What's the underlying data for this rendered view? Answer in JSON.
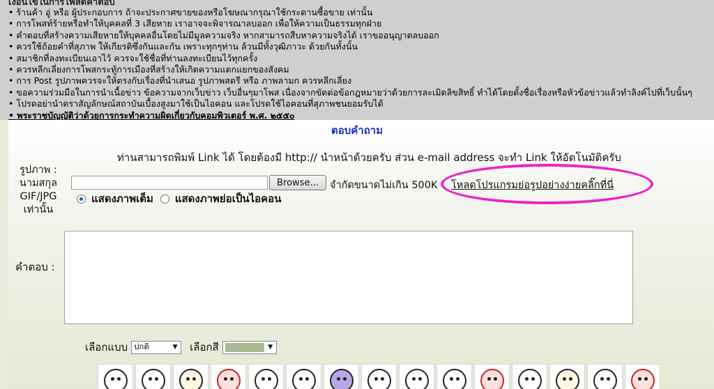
{
  "rules": {
    "heading": "เงื่อนไขในการโพสต์คำตอบ",
    "items": [
      "ร้านค้า อู่ หรือ ผู้ประกอบการ ถ้าจะประกาศขายของหรือโฆษณากรุณาใช้กระดานซื้อขาย เท่านั้น",
      "การโพสท์ร้ายหรือทำให้บุคคลที่ 3 เสียหาย เราอาจจะพิจารณาลบออก เพื่อให้ความเป็นธรรมทุกฝ่าย",
      "คำตอบที่สร้างความเสียหายให้บุคคลอื่นโดยไม่มีมูลความจริง หากสามารถสืบหาความจริงได้ เราขออนุญาตลบออก",
      "ควรใช้ถ้อยคำที่สุภาพ ให้เกียรติซึ่งกันและกัน เพราะทุกๆท่าน ล้วนมีทั้งวุฒิภาวะ ด้วยกันทั้งนั้น",
      "สมาชิกที่ลงทะเบียนเอาไว้ ควรจะใช้ชื่อที่ท่านลงทะเบียนไว้ทุกครั้ง",
      "ควรหลีกเลี่ยงการโพสกระทู้การเมืองที่สร้างให้เกิดความแตกแยกของสังคม",
      "การ Post รูปภาพควรจะให้ตรงกับเรื่องที่นำเสนอ รูปภาพสตรี หรือ ภาพลามก ควรหลีกเลี่ยง",
      "ขอความร่วมมือในการนำเนื้อข่าว ข้อความจากเว็บข่าว เว็บอื่นๆมาโพส เนื่องจากขัดต่อข้อกฎหมายว่าด้วยการละเมิดลิขสิทธิ์ ทำได้โดยตั้งชื่อเรื่องหรือหัวข้อข่าวแล้วทำลิงค์ไปที่เว็บนั้นๆ",
      "โปรดอย่านำตราสัญลักษณ์สถาบันเบื้องสูงมาใช้เป็นไอคอน และโปรดใช้ไอคอนที่สุภาพชนยอมรับได้"
    ],
    "law_link": "พระราชบัญญัติว่าด้วยการกระทำความผิดเกี่ยวกับคอมพิวเตอร์ พ.ศ. ๒๕๕๐"
  },
  "form": {
    "title": "ตอบคำถาม",
    "link_note": "ท่านสามารถพิมพ์ Link ได้ โดยต้องมี http:// นำหน้าด้วยครับ ส่วน e-mail address จะทำ Link ให้อัตโนมัติครับ",
    "image_label_lines": [
      "รูปภาพ :",
      "นามสกุล",
      "GIF/JPG",
      "เท่านั้น"
    ],
    "browse_label": "Browse...",
    "size_limit": "จำกัดขนาดไม่เกิน 500K",
    "resize_link": "โหลดโปรแกรมย่อรูปอย่างง่ายคลิ๊กที่นี่",
    "radio_full": "แสดงภาพเต็ม",
    "radio_icon": "แสดงภาพย่อเป็นไอคอน",
    "answer_label": "คำตอบ :",
    "type_label": "เลือกแบบ",
    "type_value": "ปกติ",
    "color_label": "เลือกสี",
    "color_value_hex": "#a8b890",
    "oval_color": "#ee22cc",
    "title_color": "#1a2fc4"
  },
  "emoticons": [
    "spiral-eyes-icon",
    "crying-icon",
    "cat-icon",
    "angry-icon",
    "tears-icon",
    "laughing-icon",
    "purple-shy-icon",
    "sleepy-icon",
    "sad-icon",
    "annoyed-icon",
    "cat-angry-icon",
    "scared-icon",
    "cat-smile-icon",
    "happy-icon",
    "shouting-icon"
  ]
}
